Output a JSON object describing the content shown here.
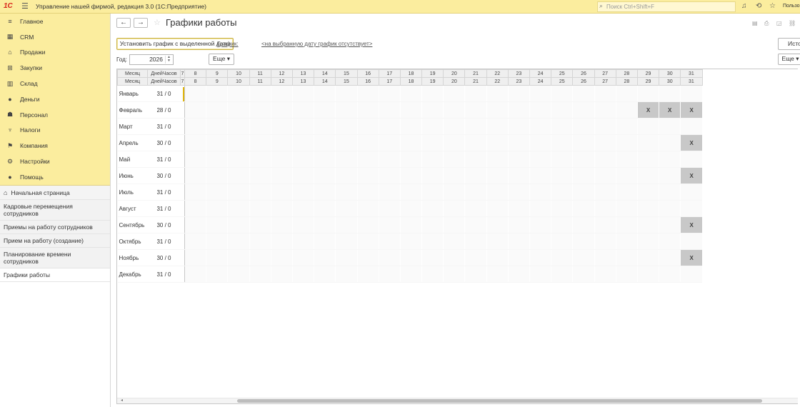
{
  "app": {
    "logo": "1С",
    "title": "Управление нашей фирмой, редакция 3.0  (1С:Предприятие)",
    "search_placeholder": "Поиск Ctrl+Shift+F",
    "user": "Пользо"
  },
  "sections": [
    {
      "label": "Главное",
      "icon": "≡"
    },
    {
      "label": "CRM",
      "icon": "▦"
    },
    {
      "label": "Продажи",
      "icon": "⌂"
    },
    {
      "label": "Закупки",
      "icon": "⊞"
    },
    {
      "label": "Склад",
      "icon": "▥"
    },
    {
      "label": "Деньги",
      "icon": "●"
    },
    {
      "label": "Персонал",
      "icon": "☗"
    },
    {
      "label": "Налоги",
      "icon": "♆"
    },
    {
      "label": "Компания",
      "icon": "⚑"
    },
    {
      "label": "Настройки",
      "icon": "⚙"
    },
    {
      "label": "Помощь",
      "icon": "●"
    }
  ],
  "home": "Начальная страница",
  "open_windows": [
    {
      "label": "Кадровые перемещения сотрудников",
      "active": false
    },
    {
      "label": "Приемы на работу сотрудников",
      "active": false
    },
    {
      "label": "Прием на работу (создание)",
      "active": false
    },
    {
      "label": "Планирование времени сотрудников",
      "active": false
    },
    {
      "label": "Графики работы",
      "active": true
    }
  ],
  "page": {
    "title": "Графики работы",
    "set_schedule_button": "Установить график с выделенной даты",
    "schedule_link_label": "График:",
    "schedule_link_value": "<на выбранную дату график отсутствует>",
    "history_button": "Исто",
    "year_label": "Год:",
    "year_value": "2026",
    "more_button": "Еще ▾",
    "more_button_right": "Еще ▾"
  },
  "grid": {
    "col_month": "Месяц",
    "col_days": "ДнейЧасов",
    "col_cut": "7",
    "days": [
      "8",
      "9",
      "10",
      "11",
      "12",
      "13",
      "14",
      "15",
      "16",
      "17",
      "18",
      "19",
      "20",
      "21",
      "22",
      "23",
      "24",
      "25",
      "26",
      "27",
      "28",
      "29",
      "30",
      "31"
    ],
    "rows": [
      {
        "month": "Январь",
        "count": "31 / 0",
        "off": []
      },
      {
        "month": "Февраль",
        "count": "28 / 0",
        "off": [
          "29",
          "30",
          "31"
        ]
      },
      {
        "month": "Март",
        "count": "31 / 0",
        "off": []
      },
      {
        "month": "Апрель",
        "count": "30 / 0",
        "off": [
          "31"
        ]
      },
      {
        "month": "Май",
        "count": "31 / 0",
        "off": []
      },
      {
        "month": "Июнь",
        "count": "30 / 0",
        "off": [
          "31"
        ]
      },
      {
        "month": "Июль",
        "count": "31 / 0",
        "off": []
      },
      {
        "month": "Август",
        "count": "31 / 0",
        "off": []
      },
      {
        "month": "Сентябрь",
        "count": "30 / 0",
        "off": [
          "31"
        ]
      },
      {
        "month": "Октябрь",
        "count": "31 / 0",
        "off": []
      },
      {
        "month": "Ноябрь",
        "count": "30 / 0",
        "off": [
          "31"
        ]
      },
      {
        "month": "Декабрь",
        "count": "31 / 0",
        "off": []
      }
    ],
    "off_mark": "X"
  }
}
